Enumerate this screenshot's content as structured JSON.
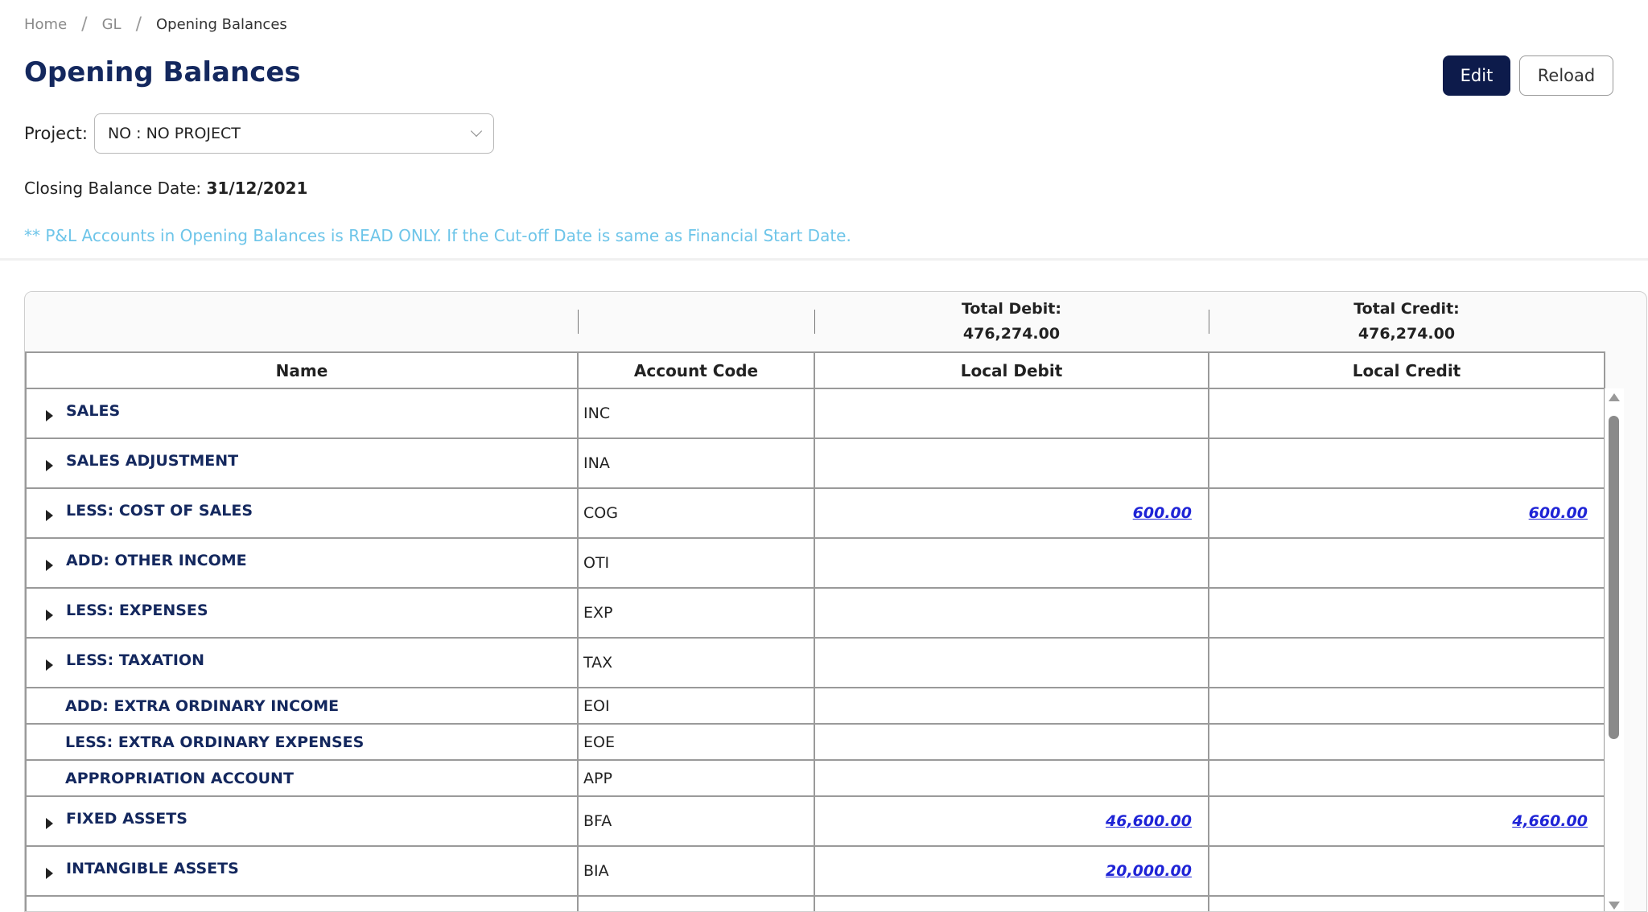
{
  "breadcrumb": {
    "home": "Home",
    "sep": "/",
    "gl": "GL",
    "current": "Opening Balances"
  },
  "page": {
    "title": "Opening Balances"
  },
  "toolbar": {
    "edit_label": "Edit",
    "reload_label": "Reload"
  },
  "project": {
    "label": "Project:",
    "value": "NO : NO PROJECT"
  },
  "closing": {
    "label": "Closing Balance Date:",
    "date": "31/12/2021"
  },
  "note": "** P&L Accounts in Opening Balances is READ ONLY. If the Cut-off Date is same as Financial Start Date.",
  "totals": {
    "debit_label": "Total Debit:",
    "debit_value": "476,274.00",
    "credit_label": "Total Credit:",
    "credit_value": "476,274.00"
  },
  "table": {
    "headers": {
      "name": "Name",
      "code": "Account Code",
      "debit": "Local Debit",
      "credit": "Local Credit"
    },
    "rows": [
      {
        "name": "SALES",
        "code": "INC",
        "debit": "",
        "credit": ""
      },
      {
        "name": "SALES ADJUSTMENT",
        "code": "INA",
        "debit": "",
        "credit": ""
      },
      {
        "name": "LESS: COST OF SALES",
        "code": "COG",
        "debit": "600.00",
        "credit": "600.00"
      },
      {
        "name": "ADD: OTHER INCOME",
        "code": "OTI",
        "debit": "",
        "credit": ""
      },
      {
        "name": "LESS: EXPENSES",
        "code": "EXP",
        "debit": "",
        "credit": ""
      },
      {
        "name": "LESS: TAXATION",
        "code": "TAX",
        "debit": "",
        "credit": ""
      },
      {
        "name": "ADD: EXTRA ORDINARY INCOME",
        "code": "EOI",
        "debit": "",
        "credit": ""
      },
      {
        "name": "LESS: EXTRA ORDINARY EXPENSES",
        "code": "EOE",
        "debit": "",
        "credit": ""
      },
      {
        "name": "APPROPRIATION ACCOUNT",
        "code": "APP",
        "debit": "",
        "credit": ""
      },
      {
        "name": "FIXED ASSETS",
        "code": "BFA",
        "debit": "46,600.00",
        "credit": "4,660.00"
      },
      {
        "name": "INTANGIBLE ASSETS",
        "code": "BIA",
        "debit": "20,000.00",
        "credit": ""
      }
    ]
  }
}
